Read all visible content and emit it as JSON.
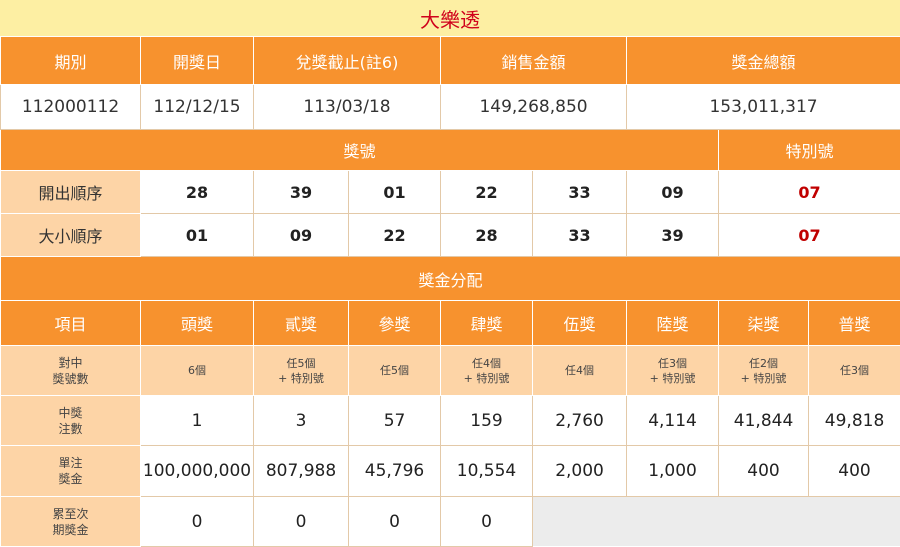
{
  "title": "大樂透",
  "summary": {
    "headers": [
      "期別",
      "開獎日",
      "兌獎截止(註6)",
      "銷售金額",
      "獎金總額"
    ],
    "values": [
      "112000112",
      "112/12/15",
      "113/03/18",
      "149,268,850",
      "153,011,317"
    ]
  },
  "numbers_header": {
    "main": "獎號",
    "special": "特別號"
  },
  "draw_order": {
    "label": "開出順序",
    "numbers": [
      "28",
      "39",
      "01",
      "22",
      "33",
      "09"
    ],
    "special": "07"
  },
  "size_order": {
    "label": "大小順序",
    "numbers": [
      "01",
      "09",
      "22",
      "28",
      "33",
      "39"
    ],
    "special": "07"
  },
  "prize_header": "獎金分配",
  "prizes": {
    "item_label": "項目",
    "names": [
      "頭獎",
      "貳獎",
      "參獎",
      "肆獎",
      "伍獎",
      "陸獎",
      "柒獎",
      "普獎"
    ],
    "match_label": [
      "對中",
      "獎號數"
    ],
    "match": [
      [
        "6個"
      ],
      [
        "任5個",
        "+ 特別號"
      ],
      [
        "任5個"
      ],
      [
        "任4個",
        "+ 特別號"
      ],
      [
        "任4個"
      ],
      [
        "任3個",
        "+ 特別號"
      ],
      [
        "任2個",
        "+ 特別號"
      ],
      [
        "任3個"
      ]
    ],
    "winners_label": [
      "中獎",
      "注數"
    ],
    "winners": [
      "1",
      "3",
      "57",
      "159",
      "2,760",
      "4,114",
      "41,844",
      "49,818"
    ],
    "amount_label": [
      "單注",
      "獎金"
    ],
    "amounts": [
      "100,000,000",
      "807,988",
      "45,796",
      "10,554",
      "2,000",
      "1,000",
      "400",
      "400"
    ],
    "rollover_label": [
      "累至次",
      "期獎金"
    ],
    "rollover": [
      "0",
      "0",
      "0",
      "0"
    ]
  },
  "colors": {
    "header_bg": "#f7922e",
    "label_bg": "#fdd4a6",
    "title_bg": "#fdefa3",
    "title_text": "#d0021b",
    "special_text": "#c00000"
  }
}
